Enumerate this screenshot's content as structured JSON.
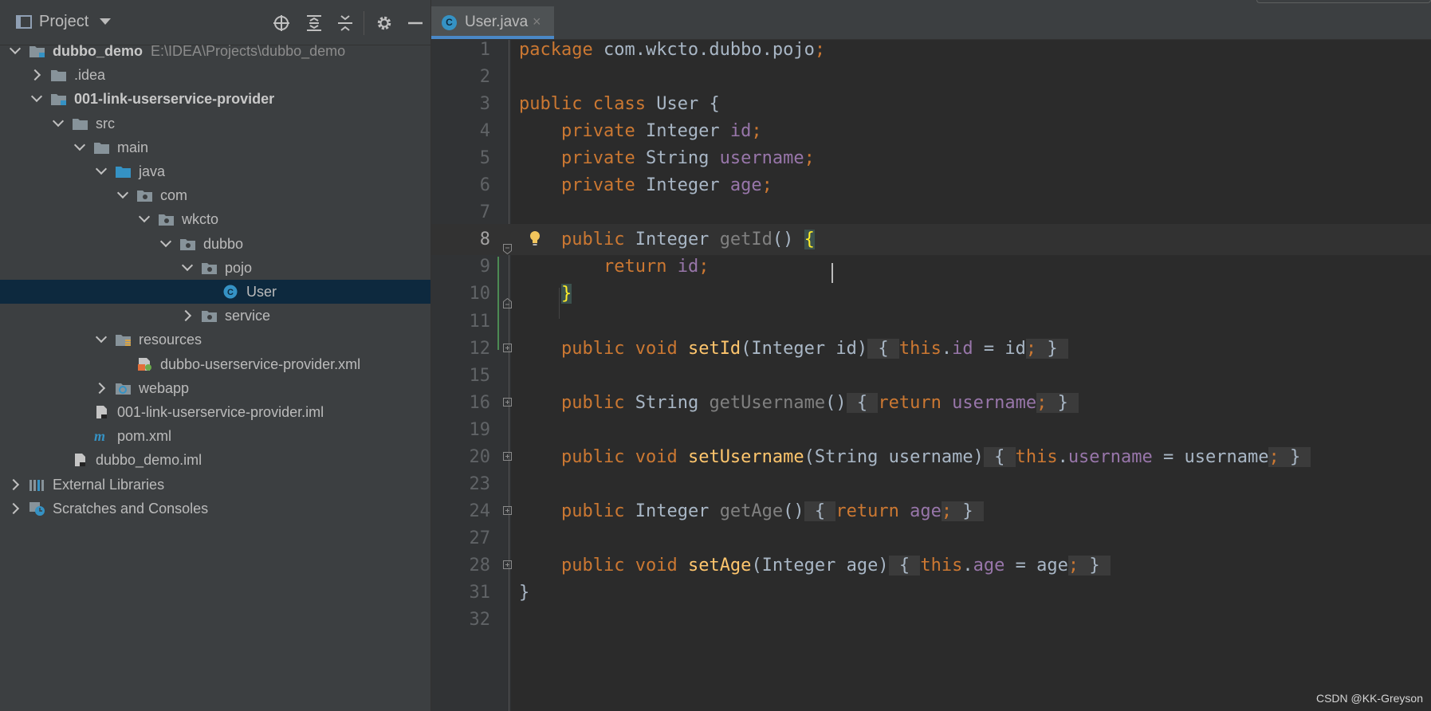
{
  "project_panel": {
    "title": "Project",
    "tools": [
      "locate-icon",
      "expand-all-icon",
      "collapse-all-icon",
      "gear-icon",
      "minimize-icon"
    ]
  },
  "tree": [
    {
      "label": "dubbo_demo",
      "path": "E:\\IDEA\\Projects\\dubbo_demo",
      "bold": true,
      "icon": "module-folder-icon",
      "state": "open"
    },
    {
      "label": ".idea",
      "icon": "folder-icon",
      "state": "closed"
    },
    {
      "label": "001-link-userservice-provider",
      "bold": true,
      "icon": "module-folder-icon",
      "state": "open"
    },
    {
      "label": "src",
      "icon": "folder-icon",
      "state": "open"
    },
    {
      "label": "main",
      "icon": "folder-icon",
      "state": "open"
    },
    {
      "label": "java",
      "icon": "source-folder-icon",
      "state": "open"
    },
    {
      "label": "com",
      "icon": "package-icon",
      "state": "open"
    },
    {
      "label": "wkcto",
      "icon": "package-icon",
      "state": "open"
    },
    {
      "label": "dubbo",
      "icon": "package-icon",
      "state": "open"
    },
    {
      "label": "pojo",
      "icon": "package-icon",
      "state": "open"
    },
    {
      "label": "User",
      "icon": "java-class-icon",
      "state": "none",
      "selected": true
    },
    {
      "label": "service",
      "icon": "package-icon",
      "state": "closed"
    },
    {
      "label": "resources",
      "icon": "resources-folder-icon",
      "state": "open"
    },
    {
      "label": "dubbo-userservice-provider.xml",
      "icon": "spring-xml-icon",
      "state": "none"
    },
    {
      "label": "webapp",
      "icon": "web-folder-icon",
      "state": "closed"
    },
    {
      "label": "001-link-userservice-provider.iml",
      "icon": "iml-file-icon",
      "state": "none"
    },
    {
      "label": "pom.xml",
      "icon": "maven-icon",
      "state": "none"
    },
    {
      "label": "dubbo_demo.iml",
      "icon": "iml-file-icon",
      "state": "none"
    },
    {
      "label": "External Libraries",
      "icon": "libraries-icon",
      "state": "closed"
    },
    {
      "label": "Scratches and Consoles",
      "icon": "scratches-icon",
      "state": "closed"
    }
  ],
  "editor": {
    "tab": {
      "label": "User.java",
      "close": "×",
      "icon": "java-class-icon",
      "icon_letter": "C"
    },
    "lines": [
      {
        "num": "1",
        "code": "package com.wkcto.dubbo.pojo;"
      },
      {
        "num": "2",
        "code": ""
      },
      {
        "num": "3",
        "code": "public class User {"
      },
      {
        "num": "4",
        "code": "    private Integer id;"
      },
      {
        "num": "5",
        "code": "    private String username;"
      },
      {
        "num": "6",
        "code": "    private Integer age;"
      },
      {
        "num": "7",
        "code": ""
      },
      {
        "num": "8",
        "code": "    public Integer getId() {"
      },
      {
        "num": "9",
        "code": "        return id;"
      },
      {
        "num": "10",
        "code": "    }"
      },
      {
        "num": "11",
        "code": ""
      },
      {
        "num": "12",
        "code": "    public void setId(Integer id) { this.id = id; }"
      },
      {
        "num": "15",
        "code": ""
      },
      {
        "num": "16",
        "code": "    public String getUsername() { return username; }"
      },
      {
        "num": "19",
        "code": ""
      },
      {
        "num": "20",
        "code": "    public void setUsername(String username) { this.username = username; }"
      },
      {
        "num": "23",
        "code": ""
      },
      {
        "num": "24",
        "code": "    public Integer getAge() { return age; }"
      },
      {
        "num": "27",
        "code": ""
      },
      {
        "num": "28",
        "code": "    public void setAge(Integer age) { this.age = age; }"
      },
      {
        "num": "31",
        "code": "}"
      },
      {
        "num": "32",
        "code": ""
      }
    ],
    "current_line": "8"
  },
  "watermark": "CSDN @KK-Greyson",
  "colors": {
    "keyword": "#cc7832",
    "field": "#9876aa",
    "method_decl": "#ffc66d",
    "unused_method": "#808080",
    "text": "#a9b7c6",
    "selection": "#0d293e",
    "accent": "#4a88c7"
  }
}
